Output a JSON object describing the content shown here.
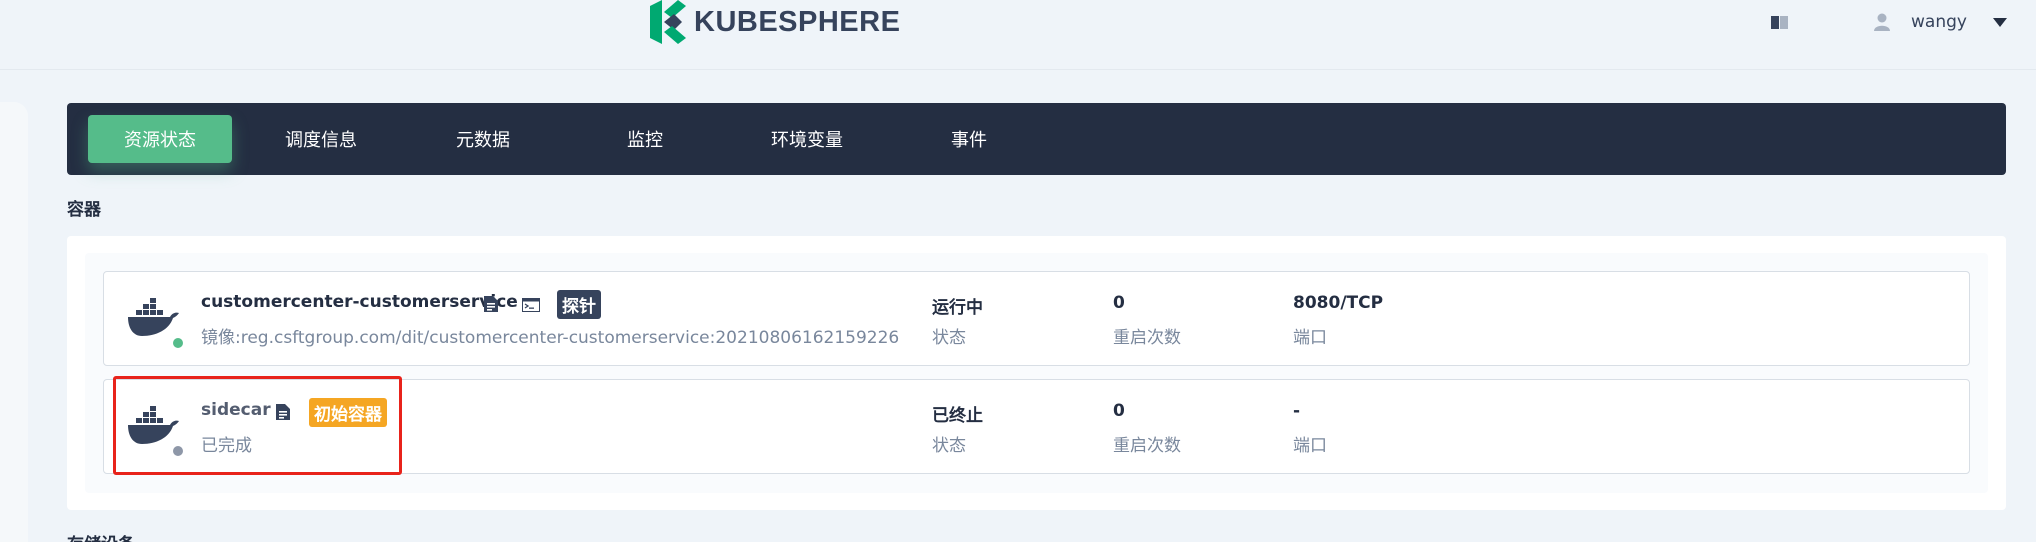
{
  "header": {
    "logo_text": "KUBESPHERE",
    "user_name": "wangy",
    "icons": {
      "docs": "book-icon",
      "user": "user-icon",
      "caret": "caret-down-icon"
    }
  },
  "tabs": [
    {
      "label": "资源状态",
      "active": true
    },
    {
      "label": "调度信息",
      "active": false
    },
    {
      "label": "元数据",
      "active": false
    },
    {
      "label": "监控",
      "active": false
    },
    {
      "label": "环境变量",
      "active": false
    },
    {
      "label": "事件",
      "active": false
    }
  ],
  "containers_section": {
    "title": "容器",
    "items": [
      {
        "name": "customercenter-customerservice",
        "image": "镜像:reg.csftgroup.com/dit/customercenter-customerservice:20210806162159226",
        "tag": "探针",
        "status_value": "运行中",
        "status_label": "状态",
        "status_color": "#55bc8a",
        "restarts_value": "0",
        "restarts_label": "重启次数",
        "ports_value": "8080/TCP",
        "ports_label": "端口"
      },
      {
        "name": "sidecar",
        "image": "已完成",
        "tag": "初始容器",
        "status_value": "已终止",
        "status_label": "状态",
        "status_color": "#8e97a8",
        "restarts_value": "0",
        "restarts_label": "重启次数",
        "ports_value": "-",
        "ports_label": "端口"
      }
    ]
  },
  "next_section": {
    "title": "存储设备"
  },
  "colors": {
    "nav_bg": "#242e42",
    "active_tab": "#55bc8a",
    "tag_probe": "#36435c",
    "tag_init": "#f5a623",
    "highlight": "#e8231b"
  }
}
